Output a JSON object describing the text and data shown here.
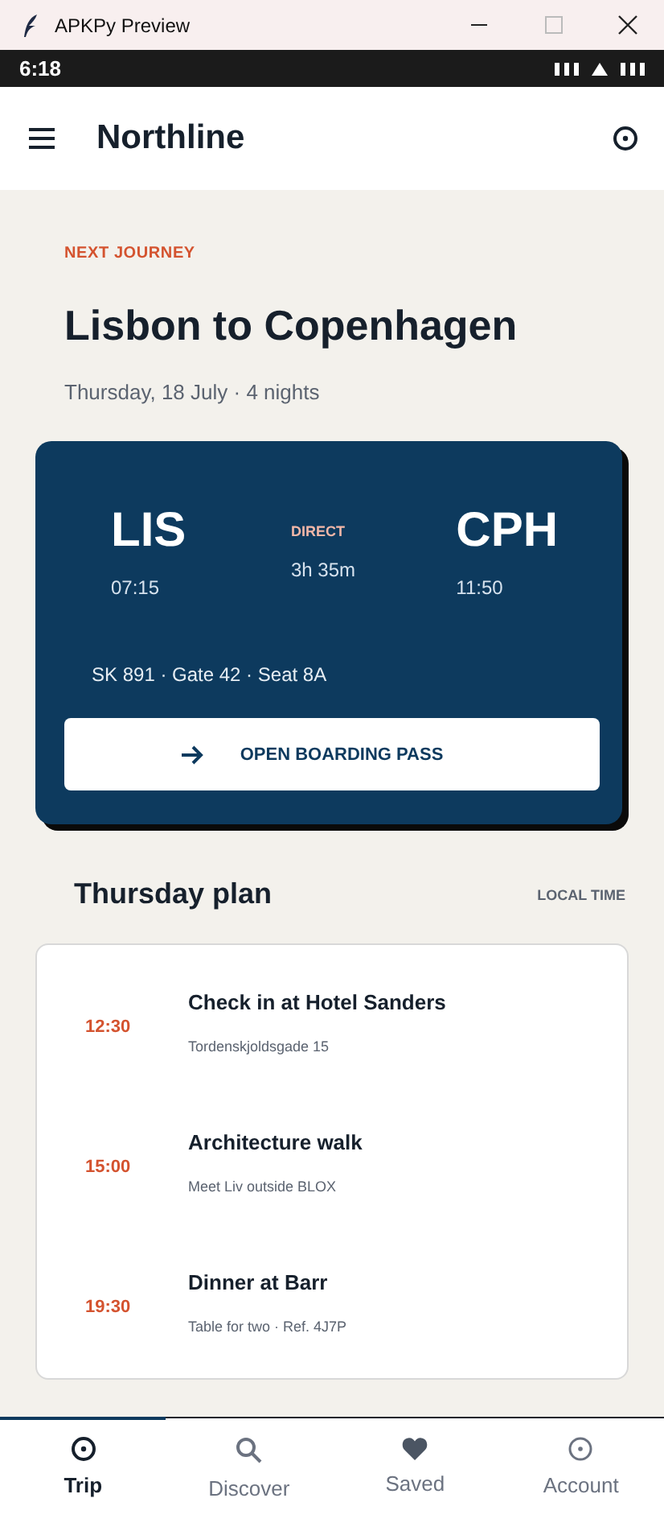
{
  "window": {
    "title": "APKPy Preview"
  },
  "status_bar": {
    "time": "6:18"
  },
  "app_bar": {
    "title": "Northline"
  },
  "journey": {
    "eyebrow": "NEXT JOURNEY",
    "title": "Lisbon to Copenhagen",
    "subtitle": "Thursday, 18 July · 4 nights"
  },
  "flight": {
    "origin": {
      "code": "LIS",
      "time": "07:15"
    },
    "route": {
      "label": "DIRECT",
      "duration": "3h 35m"
    },
    "destination": {
      "code": "CPH",
      "time": "11:50"
    },
    "details": "SK 891 · Gate 42 · Seat 8A",
    "action": "OPEN BOARDING PASS"
  },
  "plan": {
    "title": "Thursday plan",
    "note": "LOCAL TIME",
    "items": [
      {
        "time": "12:30",
        "title": "Check in at Hotel Sanders",
        "detail": "Tordenskjoldsgade 15"
      },
      {
        "time": "15:00",
        "title": "Architecture walk",
        "detail": "Meet Liv outside BLOX"
      },
      {
        "time": "19:30",
        "title": "Dinner at Barr",
        "detail": "Table for two · Ref. 4J7P"
      }
    ]
  },
  "tabs": [
    {
      "label": "Trip",
      "selected": true
    },
    {
      "label": "Discover",
      "selected": false
    },
    {
      "label": "Saved",
      "selected": false
    },
    {
      "label": "Account",
      "selected": false
    }
  ]
}
